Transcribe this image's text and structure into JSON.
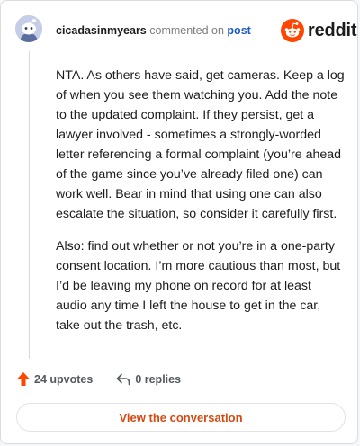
{
  "comment": {
    "username": "cicadasinmyears",
    "action_text": "commented on",
    "link_text": "post",
    "body": [
      "NTA. As others have said, get cameras. Keep a log of when you see them watching you. Add the note to the updated complaint. If they persist, get a lawyer involved - sometimes a strongly-worded letter referencing a formal complaint (you’re ahead of the game since you’ve already filed one) can work well. Bear in mind that using one can also escalate the situation, so consider it carefully first.",
      "Also: find out whether or not you’re in a one-party consent location. I’m more cautious than most, but I’d be leaving my phone on record for at least audio any time I left the house to get in the car, take out the trash, etc."
    ]
  },
  "logo": {
    "text": "reddit",
    "icon": "reddit-alien-icon",
    "color": "#ff4500"
  },
  "stats": {
    "upvotes": "24 upvotes",
    "upvote_icon": "upvote-arrow-icon",
    "replies": "0 replies",
    "reply_icon": "reply-arrow-icon"
  },
  "cta": {
    "label": "View the conversation",
    "color": "#d34b13"
  },
  "colors": {
    "link": "#1e5cc0",
    "upvote": "#ff4500"
  }
}
